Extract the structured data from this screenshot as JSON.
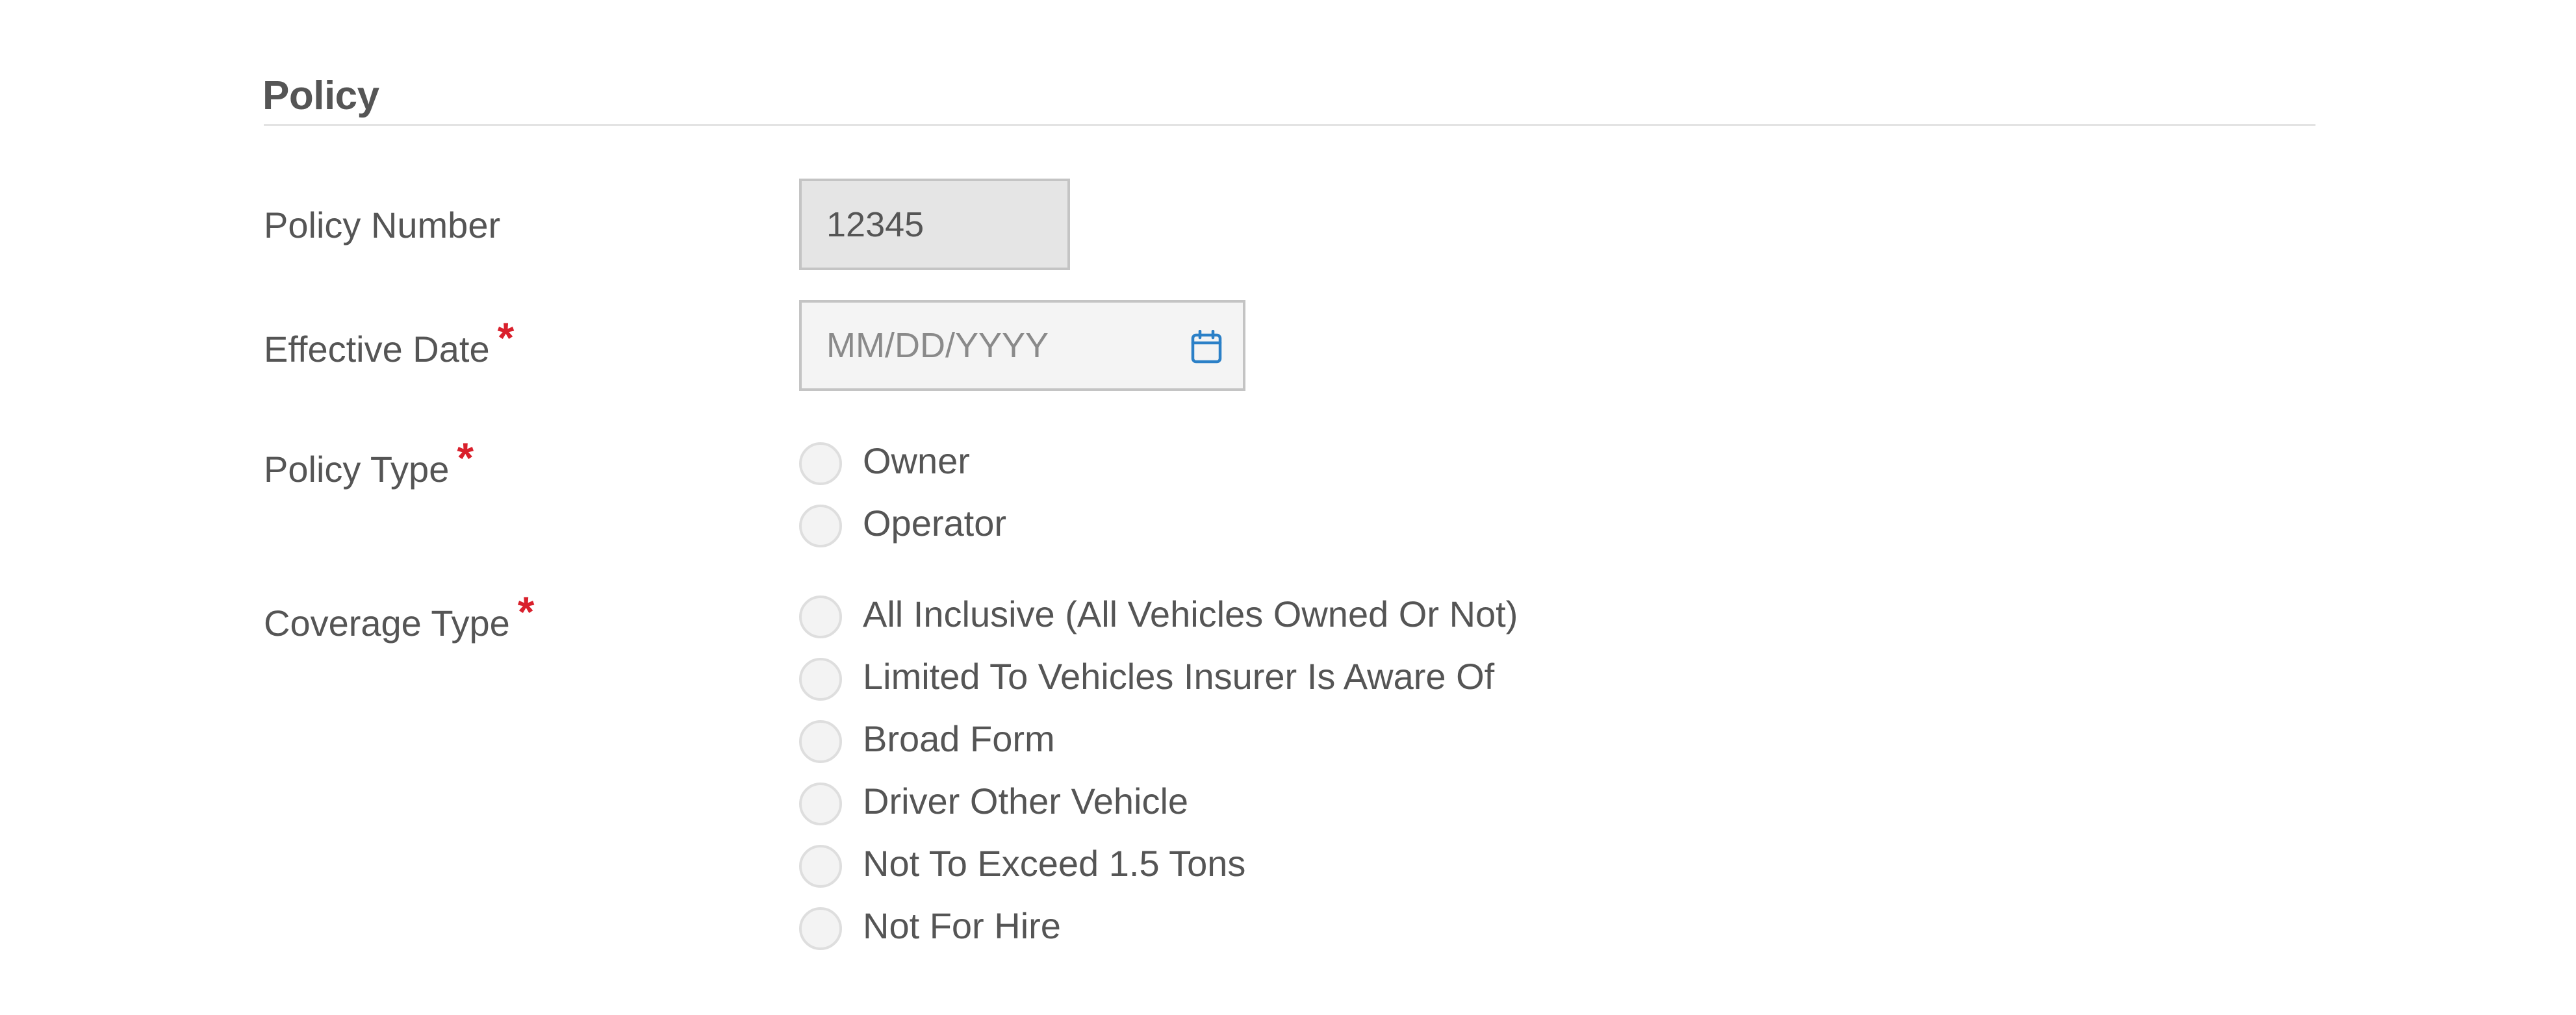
{
  "section": {
    "title": "Policy"
  },
  "fields": {
    "policy_number": {
      "label": "Policy Number",
      "value": "12345",
      "disabled": true
    },
    "effective_date": {
      "label": "Effective Date",
      "required_marker": "*",
      "value": "",
      "placeholder": "MM/DD/YYYY",
      "icon": "calendar-icon"
    },
    "policy_type": {
      "label": "Policy Type",
      "required_marker": "*",
      "options": [
        {
          "label": "Owner",
          "selected": false
        },
        {
          "label": "Operator",
          "selected": false
        }
      ]
    },
    "coverage_type": {
      "label": "Coverage Type",
      "required_marker": "*",
      "options": [
        {
          "label": "All Inclusive (All Vehicles Owned Or Not)",
          "selected": false
        },
        {
          "label": "Limited To Vehicles Insurer Is Aware Of",
          "selected": false
        },
        {
          "label": "Broad Form",
          "selected": false
        },
        {
          "label": "Driver Other Vehicle",
          "selected": false
        },
        {
          "label": "Not To Exceed 1.5 Tons",
          "selected": false
        },
        {
          "label": "Not For Hire",
          "selected": false
        }
      ]
    }
  },
  "colors": {
    "text": "#555555",
    "required": "#d9202c",
    "accent_icon": "#2b80c7",
    "input_border": "#c4c4c4",
    "disabled_input_bg": "#e5e5e5",
    "input_bg": "#f4f4f4",
    "divider": "#e3e3e3"
  }
}
